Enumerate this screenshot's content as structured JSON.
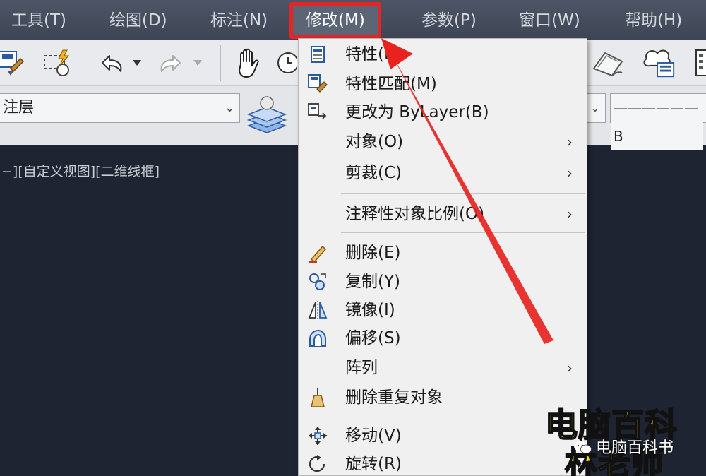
{
  "menubar": {
    "items": [
      {
        "label": "工具(T)"
      },
      {
        "label": "绘图(D)"
      },
      {
        "label": "标注(N)"
      },
      {
        "label": "修改(M)"
      },
      {
        "label": "参数(P)"
      },
      {
        "label": "窗口(W)"
      },
      {
        "label": "帮助(H)"
      }
    ]
  },
  "propbar": {
    "layer_value": "注层",
    "linetype_value": "—————— B"
  },
  "viewport": {
    "label": "−][自定义视图][二维线框]"
  },
  "modify_menu": {
    "items": [
      {
        "label": "特性(P)",
        "icon": "properties-icon",
        "submenu": false
      },
      {
        "label": "特性匹配(M)",
        "icon": "match-properties-icon",
        "submenu": false
      },
      {
        "label": "更改为 ByLayer(B)",
        "icon": "change-to-bylayer-icon",
        "submenu": false
      },
      {
        "label": "对象(O)",
        "icon": "",
        "submenu": true
      },
      {
        "label": "剪裁(C)",
        "icon": "",
        "submenu": true
      },
      {
        "label": "注释性对象比例(O)",
        "icon": "",
        "submenu": true
      },
      {
        "label": "删除(E)",
        "icon": "erase-icon",
        "submenu": false
      },
      {
        "label": "复制(Y)",
        "icon": "copy-icon",
        "submenu": false
      },
      {
        "label": "镜像(I)",
        "icon": "mirror-icon",
        "submenu": false
      },
      {
        "label": "偏移(S)",
        "icon": "offset-icon",
        "submenu": false
      },
      {
        "label": "阵列",
        "icon": "",
        "submenu": true
      },
      {
        "label": "删除重复对象",
        "icon": "delete-duplicates-icon",
        "submenu": false
      },
      {
        "label": "移动(V)",
        "icon": "move-icon",
        "submenu": false
      },
      {
        "label": "旋转(R)",
        "icon": "rotate-icon",
        "submenu": false
      }
    ],
    "submenu_arrow": "›"
  },
  "watermark": {
    "line1": "电脑百科",
    "brand": "电脑百科书",
    "line2": "林老师"
  },
  "colors": {
    "highlight_border": "#e52525",
    "arrow": "#e8231f",
    "watermark_text": "#ffe000"
  }
}
